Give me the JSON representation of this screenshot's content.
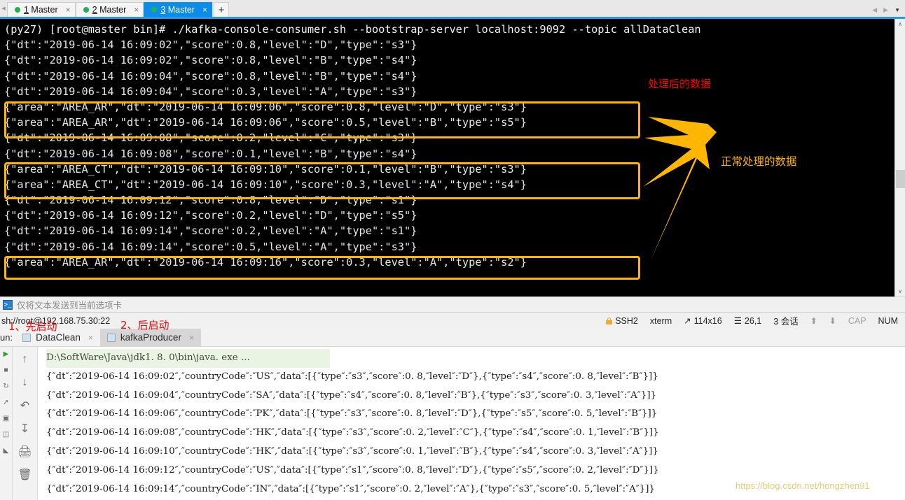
{
  "terminal_tabs": {
    "tabs": [
      {
        "num": "1",
        "label": " Master",
        "close": "×"
      },
      {
        "num": "2",
        "label": " Master",
        "close": "×"
      },
      {
        "num": "3",
        "label": " Master",
        "close": "×"
      }
    ],
    "add_label": "+",
    "nav_left": "◀",
    "nav_right": "▶",
    "nav_caret": "▼"
  },
  "terminal": {
    "prompt_line": "(py27) [root@master bin]# ./kafka-console-consumer.sh --bootstrap-server localhost:9092 --topic allDataClean",
    "lines": [
      "{\"dt\":\"2019-06-14 16:09:02\",\"score\":0.8,\"level\":\"D\",\"type\":\"s3\"}",
      "{\"dt\":\"2019-06-14 16:09:02\",\"score\":0.8,\"level\":\"B\",\"type\":\"s4\"}",
      "{\"dt\":\"2019-06-14 16:09:04\",\"score\":0.8,\"level\":\"B\",\"type\":\"s4\"}",
      "{\"dt\":\"2019-06-14 16:09:04\",\"score\":0.3,\"level\":\"A\",\"type\":\"s3\"}",
      "{\"area\":\"AREA_AR\",\"dt\":\"2019-06-14 16:09:06\",\"score\":0.8,\"level\":\"D\",\"type\":\"s3\"}",
      "{\"area\":\"AREA_AR\",\"dt\":\"2019-06-14 16:09:06\",\"score\":0.5,\"level\":\"B\",\"type\":\"s5\"}",
      "{\"dt\":\"2019-06-14 16:09:08\",\"score\":0.2,\"level\":\"C\",\"type\":\"s3\"}",
      "{\"dt\":\"2019-06-14 16:09:08\",\"score\":0.1,\"level\":\"B\",\"type\":\"s4\"}",
      "{\"area\":\"AREA_CT\",\"dt\":\"2019-06-14 16:09:10\",\"score\":0.1,\"level\":\"B\",\"type\":\"s3\"}",
      "{\"area\":\"AREA_CT\",\"dt\":\"2019-06-14 16:09:10\",\"score\":0.3,\"level\":\"A\",\"type\":\"s4\"}",
      "{\"dt\":\"2019-06-14 16:09:12\",\"score\":0.8,\"level\":\"D\",\"type\":\"s1\"}",
      "{\"dt\":\"2019-06-14 16:09:12\",\"score\":0.2,\"level\":\"D\",\"type\":\"s5\"}",
      "{\"dt\":\"2019-06-14 16:09:14\",\"score\":0.2,\"level\":\"A\",\"type\":\"s1\"}",
      "{\"dt\":\"2019-06-14 16:09:14\",\"score\":0.5,\"level\":\"A\",\"type\":\"s3\"}",
      "{\"area\":\"AREA_AR\",\"dt\":\"2019-06-14 16:09:16\",\"score\":0.3,\"level\":\"A\",\"type\":\"s2\"}"
    ],
    "scroll_up": "∧",
    "scroll_down": "∨"
  },
  "annotations": {
    "processed_data": "处理后的数据",
    "normal_processed_data": "正常处理的数据",
    "start_first": "1、先启动",
    "start_second": "2、后启动",
    "highlight_color": "#FFB600",
    "red_color": "#FF0000"
  },
  "send_bar": {
    "icon": "send-to-tab-icon",
    "text": "仅将文本发送到当前选项卡"
  },
  "status_bar": {
    "connection": "sh://root@192.168.75.30:22",
    "protocol": "SSH2",
    "emulation": "xterm",
    "size": "114x16",
    "cursor": "26,1",
    "sessions": "3 会话",
    "cap": "CAP",
    "num": "NUM",
    "up_arrow": "⬆",
    "down_arrow": "⬇"
  },
  "ide": {
    "run_label": "un:",
    "tabs": [
      {
        "label": "DataClean",
        "close": "×",
        "active": false
      },
      {
        "label": "kafkaProducer",
        "close": "×",
        "active": true
      }
    ],
    "command_line": "D:\\SoftWare\\Java\\jdk1. 8. 0\\bin\\java. exe ...",
    "gutter_icons": [
      "run-icon",
      "stop-icon",
      "rerun-icon",
      "dump-threads-icon",
      "camera-icon",
      "layout-icon",
      "pin-icon"
    ],
    "toolbar_icons": [
      "scroll-up-icon",
      "scroll-down-icon",
      "soft-wrap-icon",
      "scroll-to-end-icon",
      "print-icon",
      "trash-icon"
    ],
    "console_lines": [
      "{″dt″:″2019-06-14 16:09:02″,″countryCode″:″US″,″data″:[{″type″:″s3″,″score″:0. 8,″level″:″D″},{″type″:″s4″,″score″:0. 8,″level″:″B″}]}",
      "{″dt″:″2019-06-14 16:09:04″,″countryCode″:″SA″,″data″:[{″type″:″s4″,″score″:0. 8,″level″:″B″},{″type″:″s3″,″score″:0. 3,″level″:″A″}]}",
      "{″dt″:″2019-06-14 16:09:06″,″countryCode″:″PK″,″data″:[{″type″:″s3″,″score″:0. 8,″level″:″D″},{″type″:″s5″,″score″:0. 5,″level″:″B″}]}",
      "{″dt″:″2019-06-14 16:09:08″,″countryCode″:″HK″,″data″:[{″type″:″s3″,″score″:0. 2,″level″:″C″},{″type″:″s4″,″score″:0. 1,″level″:″B″}]}",
      "{″dt″:″2019-06-14 16:09:10″,″countryCode″:″HK″,″data″:[{″type″:″s3″,″score″:0. 1,″level″:″B″},{″type″:″s4″,″score″:0. 3,″level″:″A″}]}",
      "{″dt″:″2019-06-14 16:09:12″,″countryCode″:″US″,″data″:[{″type″:″s1″,″score″:0. 8,″level″:″D″},{″type″:″s5″,″score″:0. 2,″level″:″D″}]}",
      "{″dt″:″2019-06-14 16:09:14″,″countryCode″:″IN″,″data″:[{″type″:″s1″,″score″:0. 2,″level″:″A″},{″type″:″s3″,″score″:0. 5,″level″:″A″}]}"
    ]
  },
  "watermark": "https://blog.csdn.net/hongzhen91"
}
